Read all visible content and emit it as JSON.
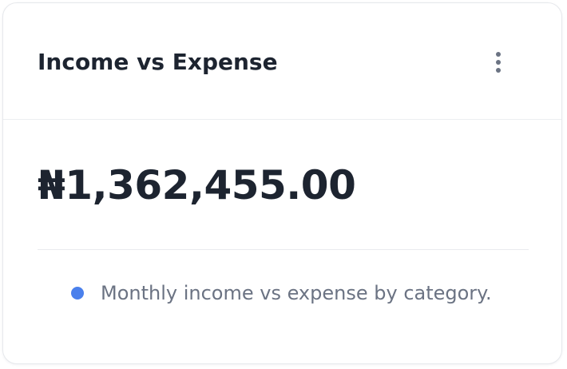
{
  "card": {
    "title": "Income vs Expense",
    "menu_icon": "vertical-ellipsis-icon",
    "amount": "₦1,362,455.00",
    "legend": {
      "text": "Monthly income vs expense by category.",
      "color": "#4a80ec"
    }
  },
  "colors": {
    "title": "#1d2430",
    "muted_text": "#6b7383",
    "menu_icon": "#6b7383",
    "border": "#e6e8ec"
  }
}
